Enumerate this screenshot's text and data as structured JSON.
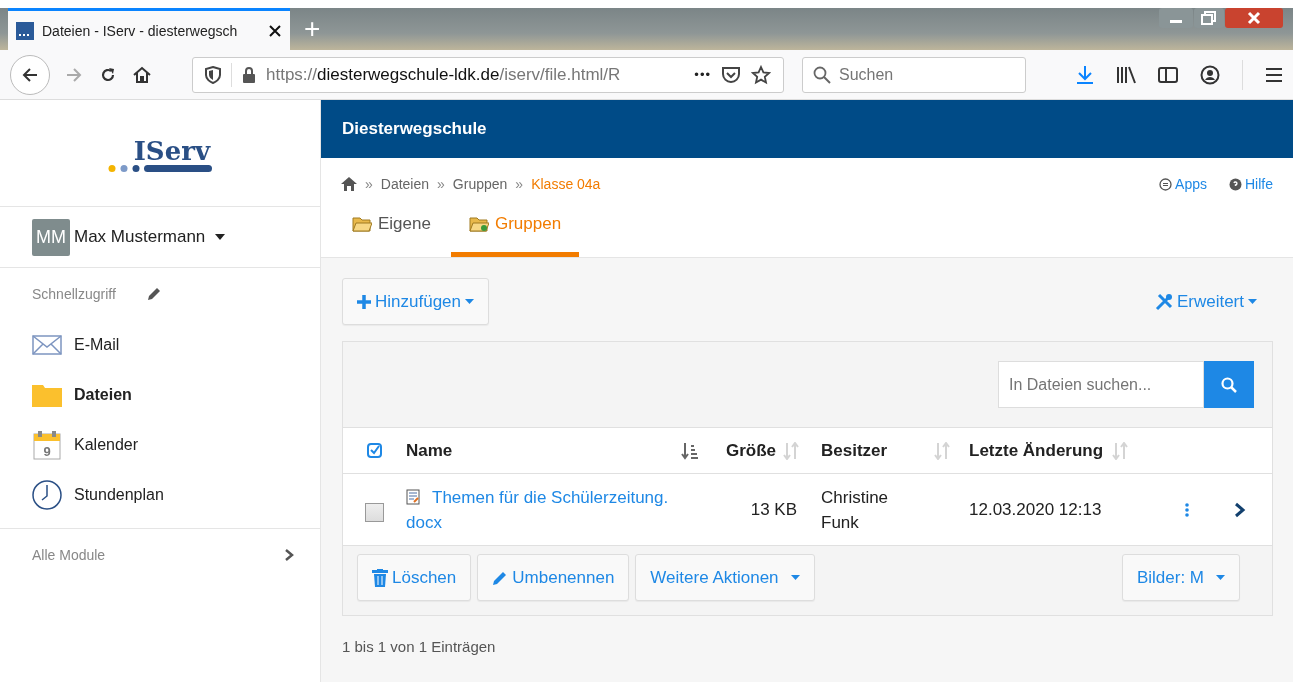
{
  "browser": {
    "tab_title": "Dateien - IServ - diesterwegsch",
    "new_tab": "+",
    "url": {
      "host": "diesterwegschule-ldk.de",
      "path": "/iserv/file.html/R",
      "scheme": "https://"
    },
    "page_actions": "•••",
    "search_placeholder": "Suchen"
  },
  "sidebar": {
    "logo": "IServ",
    "user": {
      "initials": "MM",
      "name": "Max Mustermann"
    },
    "quick_access": "Schnellzugriff",
    "items": [
      {
        "label": "E-Mail",
        "kind": "mail",
        "selected": false
      },
      {
        "label": "Dateien",
        "kind": "folder",
        "selected": true
      },
      {
        "label": "Kalender",
        "kind": "calendar",
        "day": "9",
        "selected": false
      },
      {
        "label": "Stundenplan",
        "kind": "clock",
        "selected": false
      }
    ],
    "all_modules": "Alle Module"
  },
  "header": {
    "title": "Diesterwegschule"
  },
  "breadcrumb": [
    {
      "label": "Dateien",
      "current": false
    },
    {
      "label": "Gruppen",
      "current": false
    },
    {
      "label": "Klasse 04a",
      "current": true
    }
  ],
  "breadcrumb_separator": "»",
  "top_links": [
    "Apps",
    "Hilfe"
  ],
  "tabs": [
    {
      "label": "Eigene",
      "selected": false
    },
    {
      "label": "Gruppen",
      "selected": true
    }
  ],
  "toolbar": {
    "add": "Hinzufügen",
    "advanced": "Erweitert"
  },
  "file_search": {
    "placeholder": "In Dateien suchen..."
  },
  "table": {
    "columns": [
      {
        "label": "Name",
        "sorted": true
      },
      {
        "label": "Größe",
        "sorted": false
      },
      {
        "label": "Besitzer",
        "sorted": false
      },
      {
        "label": "Letzte Änderung",
        "sorted": false
      }
    ],
    "rows": [
      {
        "name": "Themen für die Schülerzeitung.docx",
        "size": "13 KB",
        "owner": "Christine Funk",
        "modified": "12.03.2020 12:13",
        "checked": false
      }
    ]
  },
  "actions": [
    "Löschen",
    "Umbenennen",
    "Weitere Aktionen"
  ],
  "image_size": "Bilder: M",
  "footer": "1 bis 1 von 1 Einträgen"
}
